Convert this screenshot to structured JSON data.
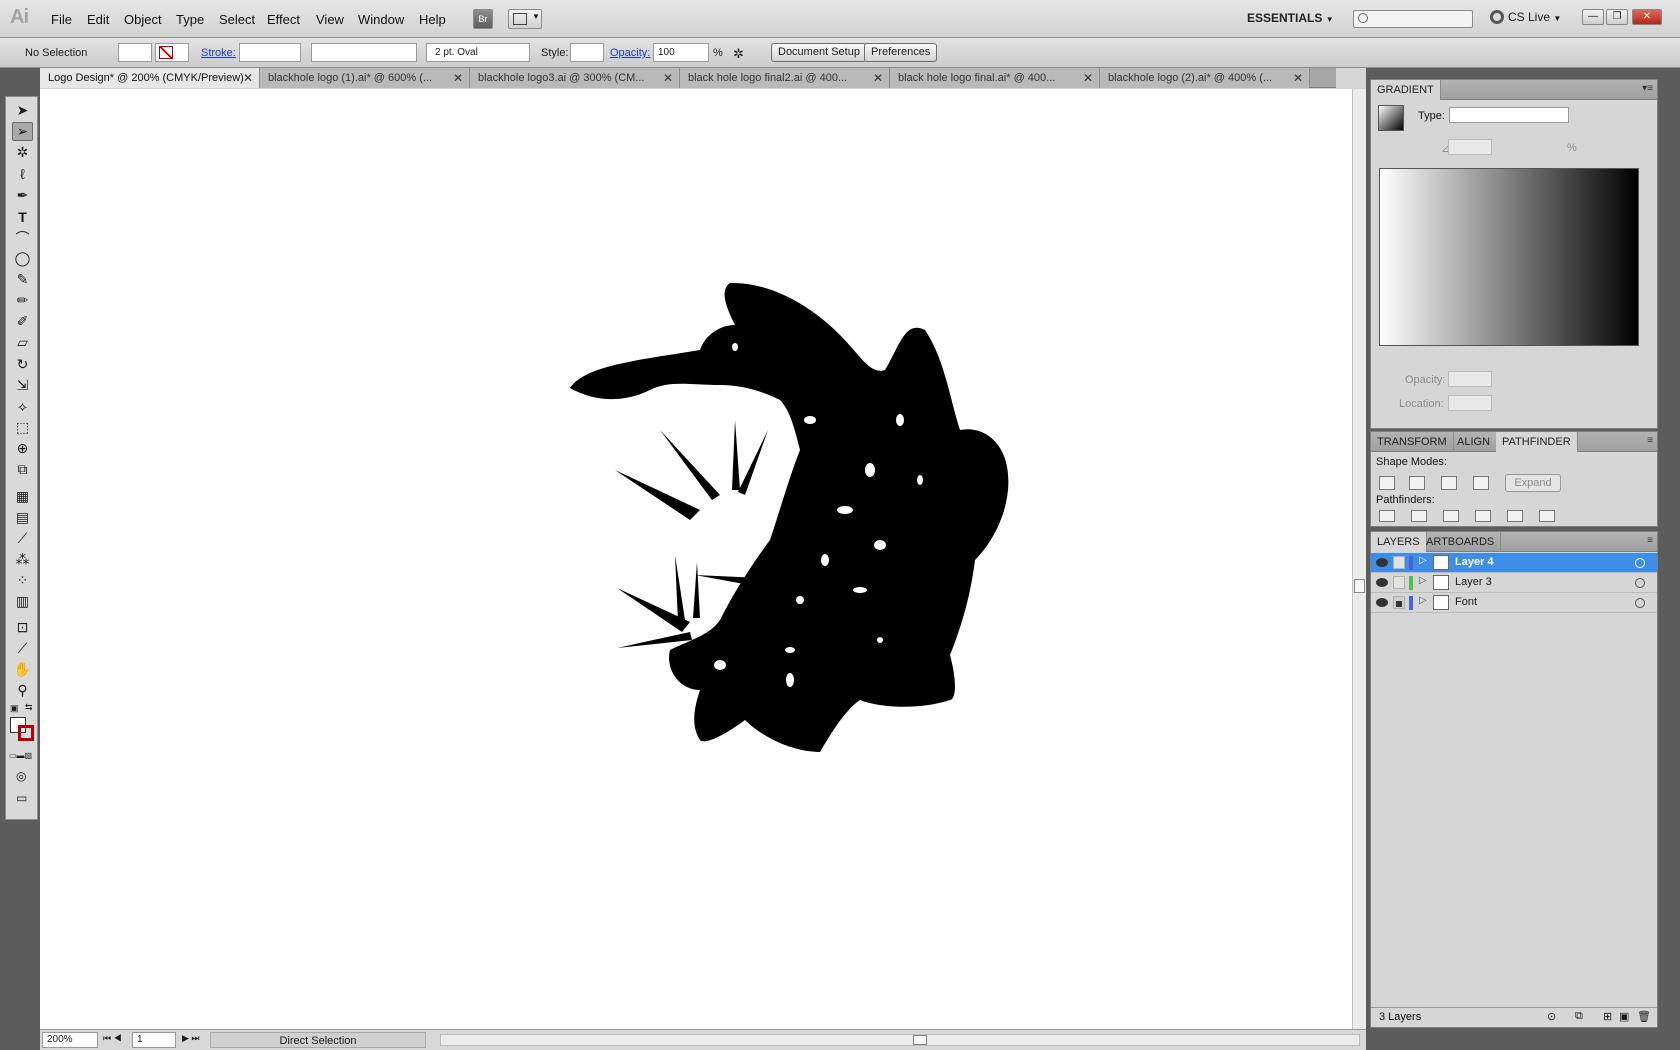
{
  "app": {
    "logo": "Ai"
  },
  "menu": [
    "File",
    "Edit",
    "Object",
    "Type",
    "Select",
    "Effect",
    "View",
    "Window",
    "Help"
  ],
  "bridge_label": "Br",
  "workspace": "ESSENTIALS",
  "cs_live": "CS Live",
  "control": {
    "selection": "No Selection",
    "stroke_label": "Stroke:",
    "brush": "2 pt. Oval",
    "style_label": "Style:",
    "opacity_label": "Opacity:",
    "opacity_value": "100",
    "percent": "%",
    "document_setup": "Document Setup",
    "preferences": "Preferences"
  },
  "tabs": [
    {
      "label": "Logo Design* @ 200% (CMYK/Preview)",
      "active": true
    },
    {
      "label": "blackhole logo (1).ai* @ 600% (...",
      "active": false
    },
    {
      "label": "blackhole logo3.ai @ 300% (CM...",
      "active": false
    },
    {
      "label": "black hole logo final2.ai @ 400...",
      "active": false
    },
    {
      "label": "black hole logo final.ai* @ 400...",
      "active": false
    },
    {
      "label": "blackhole logo (2).ai* @ 400% (...",
      "active": false
    }
  ],
  "status": {
    "zoom": "200%",
    "page": "1",
    "tool": "Direct Selection"
  },
  "gradient_panel": {
    "title": "GRADIENT",
    "type_label": "Type:",
    "percent": "%",
    "opacity_label": "Opacity:",
    "location_label": "Location:"
  },
  "pathfinder_panel": {
    "tabs": [
      "TRANSFORM",
      "ALIGN",
      "PATHFINDER"
    ],
    "active_tab": "PATHFINDER",
    "shape_modes": "Shape Modes:",
    "expand": "Expand",
    "pathfinders": "Pathfinders:"
  },
  "layers_panel": {
    "tabs": [
      "LAYERS",
      "ARTBOARDS"
    ],
    "layers": [
      {
        "name": "Layer 4",
        "color": "#4b62d8",
        "selected": true,
        "locked": false
      },
      {
        "name": "Layer 3",
        "color": "#4fc14f",
        "selected": false,
        "locked": false
      },
      {
        "name": "Font",
        "color": "#4b62d8",
        "selected": false,
        "locked": true
      }
    ],
    "count": "3 Layers"
  },
  "colors": {
    "selection": "#3d8ee6",
    "link": "#1a3fbf"
  }
}
